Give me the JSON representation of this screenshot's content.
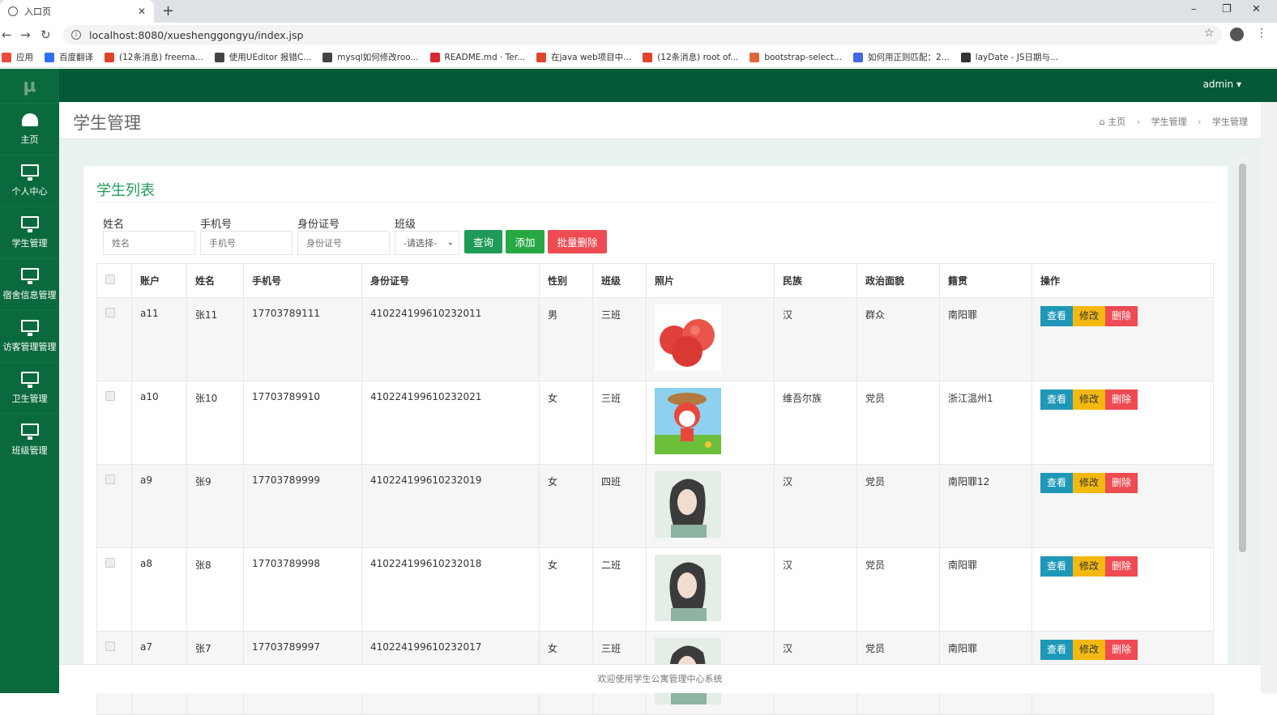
{
  "browser": {
    "tab_title": "入口页",
    "tab_close": "✕",
    "new_tab": "+",
    "url": "localhost:8080/xueshenggongyu/index.jsp",
    "window_controls": [
      "–",
      "❐",
      "✕"
    ],
    "nav": [
      "←",
      "→",
      "↻"
    ],
    "bookmarks": [
      {
        "label": "应用",
        "color": "#e84b3c"
      },
      {
        "label": "百度翻译",
        "color": "#2d6ff3"
      },
      {
        "label": "(12条消息) freema...",
        "color": "#e1442a"
      },
      {
        "label": "使用UEditor 报错C...",
        "color": "#444444"
      },
      {
        "label": "mysql如何修改roo...",
        "color": "#444444"
      },
      {
        "label": "README.md · Ter...",
        "color": "#d7282e"
      },
      {
        "label": "在java web项目中...",
        "color": "#e1442a"
      },
      {
        "label": "(12条消息) root of...",
        "color": "#e1442a"
      },
      {
        "label": "bootstrap-select...",
        "color": "#e0653b"
      },
      {
        "label": "如何用正则匹配：2...",
        "color": "#4169e1"
      },
      {
        "label": "layDate - JS日期与...",
        "color": "#333333"
      }
    ]
  },
  "sidebar": {
    "logo": "μ",
    "items": [
      {
        "label": "主页",
        "icon": "dashboard-icon"
      },
      {
        "label": "个人中心",
        "icon": "monitor-icon"
      },
      {
        "label": "学生管理",
        "icon": "monitor-icon"
      },
      {
        "label": "宿舍信息管理",
        "icon": "monitor-icon"
      },
      {
        "label": "访客管理管理",
        "icon": "monitor-icon"
      },
      {
        "label": "卫生管理",
        "icon": "monitor-icon"
      },
      {
        "label": "班级管理",
        "icon": "monitor-icon"
      }
    ]
  },
  "topbar": {
    "user": "admin ▾"
  },
  "header": {
    "title": "学生管理",
    "breadcrumb": [
      "主页",
      "学生管理",
      "学生管理"
    ],
    "home_icon": "home-icon"
  },
  "card": {
    "title": "学生列表",
    "search": {
      "name_label": "姓名",
      "name_placeholder": "姓名",
      "phone_label": "手机号",
      "phone_placeholder": "手机号",
      "id_label": "身份证号",
      "id_placeholder": "身份证号",
      "class_label": "班级",
      "class_selected": "-请选择-"
    },
    "buttons": {
      "query": "查询",
      "add": "添加",
      "batch_delete": "批量删除"
    },
    "colors": {
      "query": "#1f9b58",
      "add": "#28a745",
      "batch_delete": "#ef4b52"
    }
  },
  "table": {
    "headers": [
      "账户",
      "姓名",
      "手机号",
      "身份证号",
      "性别",
      "班级",
      "照片",
      "民族",
      "政治面貌",
      "籍贯",
      "操作"
    ],
    "rows": [
      {
        "account": "a11",
        "name": "张11",
        "phone": "17703789111",
        "id": "410224199610232011",
        "gender": "男",
        "class": "三班",
        "photo": "apple",
        "ethnic": "汉",
        "political": "群众",
        "origin": "南阳罪"
      },
      {
        "account": "a10",
        "name": "张10",
        "phone": "17703789910",
        "id": "410224199610232021",
        "gender": "女",
        "class": "三班",
        "photo": "cartoon",
        "ethnic": "维吾尔族",
        "political": "党员",
        "origin": "浙江温州1"
      },
      {
        "account": "a9",
        "name": "张9",
        "phone": "17703789999",
        "id": "410224199610232019",
        "gender": "女",
        "class": "四班",
        "photo": "girl",
        "ethnic": "汉",
        "political": "党员",
        "origin": "南阳罪12"
      },
      {
        "account": "a8",
        "name": "张8",
        "phone": "17703789998",
        "id": "410224199610232018",
        "gender": "女",
        "class": "二班",
        "photo": "girl",
        "ethnic": "汉",
        "political": "党员",
        "origin": "南阳罪"
      },
      {
        "account": "a7",
        "name": "张7",
        "phone": "17703789997",
        "id": "410224199610232017",
        "gender": "女",
        "class": "三班",
        "photo": "girl",
        "ethnic": "汉",
        "political": "党员",
        "origin": "南阳罪"
      }
    ],
    "actions": {
      "view": "查看",
      "edit": "修改",
      "delete": "删除"
    }
  },
  "footer": {
    "text": "欢迎使用学生公寓管理中心系统"
  }
}
